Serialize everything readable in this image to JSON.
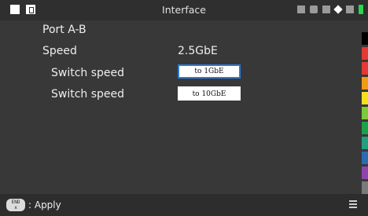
{
  "header": {
    "title": "Interface"
  },
  "port": {
    "label": "Port A-B"
  },
  "speed": {
    "label": "Speed",
    "value": "2.5GbE"
  },
  "switches": [
    {
      "label": "Switch speed",
      "button": "to 1GbE"
    },
    {
      "label": "Switch speed",
      "button": "to 10GbE"
    }
  ],
  "footer": {
    "key_top": "END",
    "key_bottom": "x",
    "apply": ": Apply"
  },
  "colors": {
    "selection_border": "#2b7bd9",
    "palette": [
      "#000000",
      "#e53935",
      "#e53935",
      "#f39c12",
      "#f4e01e",
      "#7ccb3a",
      "#16a34a",
      "#1fa07e",
      "#2b6cb0",
      "#8e44ad",
      "#7a7a7a",
      "#ffffff"
    ]
  }
}
